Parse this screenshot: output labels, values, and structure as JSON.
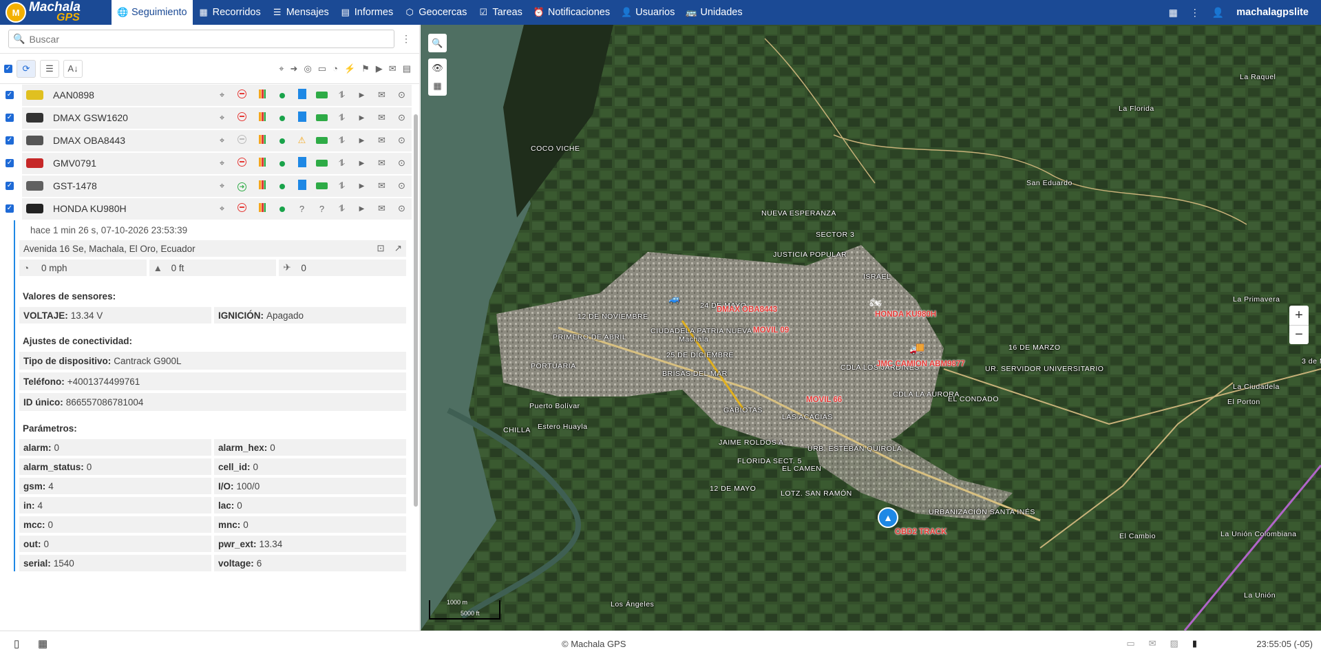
{
  "app": {
    "logo_top": "Machala",
    "logo_bottom": "GPS",
    "logo_mark": "M"
  },
  "nav": [
    {
      "label": "Seguimiento",
      "icon": "globe-icon"
    },
    {
      "label": "Recorridos",
      "icon": "history-icon"
    },
    {
      "label": "Mensajes",
      "icon": "messages-icon"
    },
    {
      "label": "Informes",
      "icon": "reports-icon"
    },
    {
      "label": "Geocercas",
      "icon": "geofence-icon"
    },
    {
      "label": "Tareas",
      "icon": "tasks-icon"
    },
    {
      "label": "Notificaciones",
      "icon": "alarm-icon"
    },
    {
      "label": "Usuarios",
      "icon": "user-icon"
    },
    {
      "label": "Unidades",
      "icon": "bus-icon"
    }
  ],
  "user": {
    "name": "machalagpslite"
  },
  "search": {
    "placeholder": "Buscar"
  },
  "units": [
    {
      "name": "AAN0898",
      "color": "#e0c020",
      "stop": "red",
      "status": "blue"
    },
    {
      "name": "DMAX GSW1620",
      "color": "#333333",
      "stop": "red",
      "status": "blue"
    },
    {
      "name": "DMAX OBA8443",
      "color": "#555555",
      "stop": "grey",
      "status": "warn"
    },
    {
      "name": "GMV0791",
      "color": "#c62828",
      "stop": "red",
      "status": "blue"
    },
    {
      "name": "GST-1478",
      "color": "#606060",
      "stop": "green",
      "status": "blue"
    },
    {
      "name": "HONDA KU980H",
      "color": "#222222",
      "stop": "red",
      "status": "unknown"
    }
  ],
  "selected": {
    "time": "hace 1 min 26 s, 07-10-2026 23:53:39",
    "address": "Avenida 16 Se, Machala, El Oro, Ecuador",
    "speed": "0 mph",
    "altitude": "0 ft",
    "satellites": "0",
    "sensors_title": "Valores de sensores:",
    "voltage_label": "VOLTAJE:",
    "voltage_value": "13.34 V",
    "ignition_label": "IGNICIÓN:",
    "ignition_value": "Apagado",
    "conn_title": "Ajustes de conectividad:",
    "device_label": "Tipo de dispositivo:",
    "device_value": "Cantrack G900L",
    "phone_label": "Teléfono:",
    "phone_value": "+4001374499761",
    "uid_label": "ID único:",
    "uid_value": "866557086781004",
    "params_title": "Parámetros:",
    "params": [
      [
        "alarm:",
        "0",
        "alarm_hex:",
        "0"
      ],
      [
        "alarm_status:",
        "0",
        "cell_id:",
        "0"
      ],
      [
        "gsm:",
        "4",
        "I/O:",
        "100/0"
      ],
      [
        "in:",
        "4",
        "lac:",
        "0"
      ],
      [
        "mcc:",
        "0",
        "mnc:",
        "0"
      ],
      [
        "out:",
        "0",
        "pwr_ext:",
        "13.34"
      ],
      [
        "serial:",
        "1540",
        "voltage:",
        "6"
      ]
    ]
  },
  "map": {
    "labels": [
      "La Raquel",
      "La Florida",
      "COCO VICHE",
      "San Eduardo",
      "NUEVA ESPERANZA",
      "SECTOR 3",
      "JUSTICIA POPULAR",
      "ISRAEL",
      "24 DE MAYO",
      "12 DE NOVIEMBRE",
      "PRIMERO DE ABRIL",
      "CIUDADELA PATRIA NUEVA",
      "Machala",
      "16 DE MARZO",
      "25 DE DICIEMBRE",
      "PORTUARIA",
      "BRISAS DEL MAR",
      "CDLA LOS JARDINES",
      "UR. SERVIDOR UNIVERSITARIO",
      "La Primavera",
      "CDLA LA AURORA",
      "EL CONDADO",
      "Puerto Bolívar",
      "GABIOTAS",
      "LAS ACACIAS",
      "El Porton",
      "La Ciudadela",
      "CHILLA",
      "Estero Huayla",
      "JAIME ROLDOS A.",
      "URB. ESTEBAN QUIROLA",
      "FLORIDA SECT. 5",
      "EL CAMEN",
      "12 DE MAYO",
      "LOTZ. SAN RAMÓN",
      "URBANIZACIÓN SANTA INÉS",
      "El Cambio",
      "La Unión Colombiana",
      "Los Ángeles",
      "La Unión",
      "3 de M"
    ],
    "vehicle_labels": [
      "DMAX OBA8443",
      "MOVIL 09",
      "HONDA KU980H",
      "JMC CAMION ABM9877",
      "MOVIL 66",
      "OBD2 TRACK"
    ],
    "scale_top": "1000 m",
    "scale_bottom": "5000 ft",
    "zoom_in": "+",
    "zoom_out": "−"
  },
  "footer": {
    "copyright": "© Machala GPS",
    "time": "23:55:05 (-05)"
  }
}
